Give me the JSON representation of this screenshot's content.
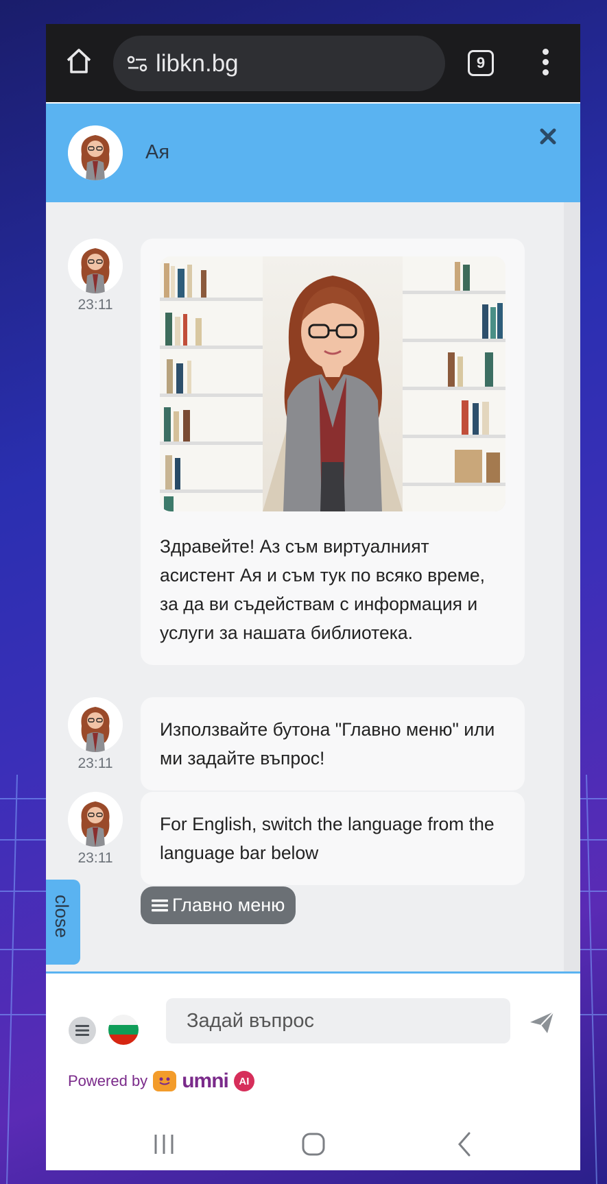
{
  "browser": {
    "url": "libkn.bg",
    "tab_count": "9"
  },
  "chat": {
    "assistant_name": "Ая",
    "messages": [
      {
        "time": "23:11",
        "text": "Здравейте! Аз съм виртуалният асистент Ая и съм тук по всяко време, за да ви съдействам с информация и услуги за нашата библиотека.",
        "has_image": true
      },
      {
        "time": "23:11",
        "text": "Използвайте бутона \"Главно меню\" или ми задайте въпрос!"
      },
      {
        "time": "23:11",
        "text": "For English, switch the language from the language bar below"
      }
    ],
    "main_menu_label": "Главно меню",
    "close_tab_label": "close",
    "input_placeholder": "Задай въпрос",
    "powered_by": "Powered by",
    "brand": "umni",
    "brand_badge": "AI"
  },
  "colors": {
    "header": "#5ab3f1",
    "chat_bg": "#eeeff1",
    "bubble": "#f8f8f9",
    "chip": "#6b7075",
    "brand": "#7a2a8a"
  }
}
